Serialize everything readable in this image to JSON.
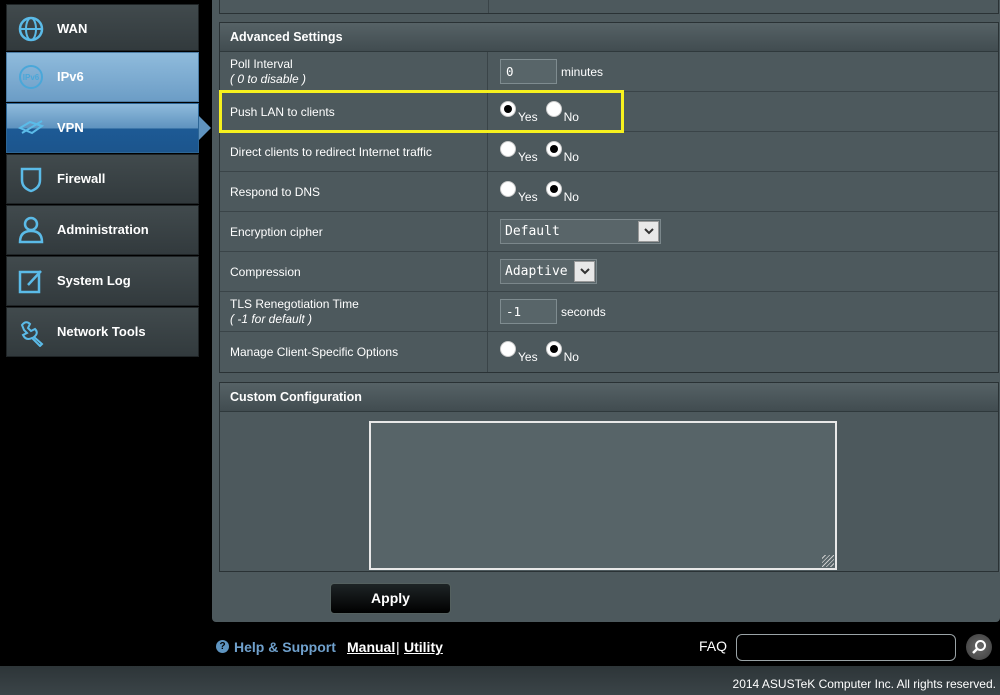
{
  "sidebar": {
    "items": [
      {
        "label": "WAN",
        "icon": "globe-icon"
      },
      {
        "label": "IPv6",
        "icon": "ipv6-icon"
      },
      {
        "label": "VPN",
        "icon": "vpn-icon"
      },
      {
        "label": "Firewall",
        "icon": "shield-icon"
      },
      {
        "label": "Administration",
        "icon": "user-icon"
      },
      {
        "label": "System Log",
        "icon": "log-icon"
      },
      {
        "label": "Network Tools",
        "icon": "wrench-icon"
      }
    ]
  },
  "advanced": {
    "header": "Advanced Settings",
    "poll_interval": {
      "label": "Poll Interval",
      "sub": "( 0 to disable )",
      "value": "0",
      "unit": "minutes"
    },
    "push_lan": {
      "label": "Push LAN to clients",
      "yes": "Yes",
      "no": "No",
      "selected": "Yes"
    },
    "redirect": {
      "label": "Direct clients to redirect Internet traffic",
      "yes": "Yes",
      "no": "No",
      "selected": "No"
    },
    "dns": {
      "label": "Respond to DNS",
      "yes": "Yes",
      "no": "No",
      "selected": "No"
    },
    "cipher": {
      "label": "Encryption cipher",
      "value": "Default"
    },
    "compression": {
      "label": "Compression",
      "value": "Adaptive"
    },
    "tls": {
      "label": "TLS Renegotiation Time",
      "sub": "( -1 for default )",
      "value": "-1",
      "unit": "seconds"
    },
    "client_specific": {
      "label": "Manage Client-Specific Options",
      "yes": "Yes",
      "no": "No",
      "selected": "No"
    }
  },
  "custom": {
    "header": "Custom Configuration",
    "value": ""
  },
  "apply_label": "Apply",
  "footer": {
    "help": "Help & Support",
    "manual": "Manual",
    "separator": "|",
    "utility": "Utility",
    "faq": "FAQ",
    "copyright": "2014 ASUSTeK Computer Inc. All rights reserved."
  },
  "colors": {
    "highlight": "#f7f11e",
    "accent": "#6fa0cc"
  }
}
